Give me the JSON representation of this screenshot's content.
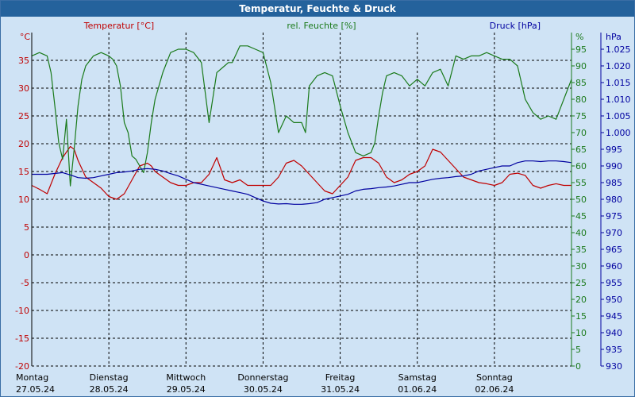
{
  "window": {
    "title": "Temperatur, Feuchte & Druck"
  },
  "colors": {
    "background": "#cfe3f5",
    "titlebar": "#24629c",
    "temperature": "#c00000",
    "humidity": "#1a7a1a",
    "pressure": "#0000a0",
    "grid": "#000000"
  },
  "chart_data": {
    "type": "line",
    "grid": true,
    "legend": "top",
    "axes": {
      "temperature": {
        "label": "Temperatur [°C]",
        "unit": "°C",
        "ylim": [
          -20,
          40
        ],
        "ticks": [
          -20,
          -15,
          -10,
          -5,
          0,
          5,
          10,
          15,
          20,
          25,
          30,
          35
        ]
      },
      "humidity": {
        "label": "rel. Feuchte [%]",
        "unit": "%",
        "ylim": [
          0,
          100
        ],
        "ticks": [
          0,
          5,
          10,
          15,
          20,
          25,
          30,
          35,
          40,
          45,
          50,
          55,
          60,
          65,
          70,
          75,
          80,
          85,
          90,
          95
        ]
      },
      "pressure": {
        "label": "Druck [hPa]",
        "unit": "hPa",
        "ylim": [
          930,
          1030
        ],
        "ticks": [
          "930",
          "935",
          "940",
          "945",
          "950",
          "955",
          "960",
          "965",
          "970",
          "975",
          "980",
          "985",
          "990",
          "995",
          "1.000",
          "1.005",
          "1.010",
          "1.015",
          "1.020",
          "1.025"
        ]
      }
    },
    "x_range": [
      0,
      7
    ],
    "days": [
      {
        "weekday": "Montag",
        "date": "27.05.24"
      },
      {
        "weekday": "Dienstag",
        "date": "28.05.24"
      },
      {
        "weekday": "Mittwoch",
        "date": "29.05.24"
      },
      {
        "weekday": "Donnerstag",
        "date": "30.05.24"
      },
      {
        "weekday": "Freitag",
        "date": "31.05.24"
      },
      {
        "weekday": "Samstag",
        "date": "01.06.24"
      },
      {
        "weekday": "Sonntag",
        "date": "02.06.24"
      }
    ],
    "series": [
      {
        "name": "Temperatur [°C]",
        "axis": "temperature",
        "x": [
          0,
          0.1,
          0.2,
          0.3,
          0.4,
          0.5,
          0.55,
          0.6,
          0.7,
          0.8,
          0.9,
          1.0,
          1.1,
          1.2,
          1.3,
          1.4,
          1.5,
          1.55,
          1.6,
          1.7,
          1.8,
          1.9,
          2.0,
          2.1,
          2.2,
          2.3,
          2.4,
          2.5,
          2.6,
          2.7,
          2.8,
          2.9,
          3.0,
          3.1,
          3.2,
          3.3,
          3.4,
          3.5,
          3.6,
          3.7,
          3.8,
          3.9,
          4.0,
          4.1,
          4.2,
          4.3,
          4.4,
          4.5,
          4.6,
          4.7,
          4.8,
          4.9,
          5.0,
          5.1,
          5.2,
          5.3,
          5.4,
          5.5,
          5.6,
          5.7,
          5.8,
          5.9,
          6.0,
          6.1,
          6.2,
          6.3,
          6.4,
          6.5,
          6.6,
          6.7,
          6.8,
          6.9,
          7.0
        ],
        "values": [
          12.5,
          11.8,
          11.0,
          14.5,
          17.5,
          19.5,
          19.0,
          17.0,
          14.0,
          13.0,
          12.0,
          10.5,
          10.0,
          11.0,
          13.5,
          16.0,
          16.5,
          16.0,
          15.0,
          14.0,
          13.0,
          12.5,
          12.5,
          13.0,
          13.0,
          14.5,
          17.5,
          13.5,
          13.0,
          13.5,
          12.5,
          12.5,
          12.5,
          12.5,
          14.0,
          16.5,
          17.0,
          16.0,
          14.5,
          13.0,
          11.5,
          11.0,
          12.5,
          14.0,
          17.0,
          17.5,
          17.5,
          16.5,
          14.0,
          13.0,
          13.5,
          14.5,
          15.0,
          16.0,
          19.0,
          18.5,
          17.0,
          15.5,
          14.0,
          13.5,
          13.0,
          12.8,
          12.5,
          13.0,
          14.5,
          14.7,
          14.3,
          12.5,
          12.0,
          12.5,
          12.8,
          12.5,
          12.5
        ]
      },
      {
        "name": "rel. Feuchte [%]",
        "axis": "humidity",
        "x": [
          0,
          0.1,
          0.2,
          0.25,
          0.3,
          0.35,
          0.4,
          0.45,
          0.5,
          0.55,
          0.6,
          0.65,
          0.7,
          0.8,
          0.9,
          1.0,
          1.05,
          1.1,
          1.15,
          1.2,
          1.25,
          1.3,
          1.35,
          1.4,
          1.45,
          1.5,
          1.55,
          1.6,
          1.7,
          1.8,
          1.9,
          2.0,
          2.1,
          2.2,
          2.3,
          2.4,
          2.5,
          2.55,
          2.6,
          2.7,
          2.8,
          2.9,
          3.0,
          3.1,
          3.2,
          3.3,
          3.4,
          3.5,
          3.55,
          3.6,
          3.7,
          3.8,
          3.9,
          4.0,
          4.1,
          4.2,
          4.3,
          4.4,
          4.45,
          4.5,
          4.55,
          4.6,
          4.7,
          4.8,
          4.9,
          5.0,
          5.1,
          5.2,
          5.3,
          5.4,
          5.5,
          5.6,
          5.7,
          5.8,
          5.9,
          6.0,
          6.1,
          6.2,
          6.3,
          6.4,
          6.5,
          6.55,
          6.6,
          6.7,
          6.8,
          6.9,
          7.0
        ],
        "values": [
          93,
          94,
          93,
          88,
          78,
          67,
          62,
          74,
          54,
          65,
          78,
          86,
          90,
          93,
          94,
          93,
          92,
          90,
          84,
          73,
          70,
          63,
          62,
          60,
          58,
          64,
          73,
          80,
          88,
          94,
          95,
          95,
          94,
          91,
          73,
          88,
          90,
          91,
          91,
          96,
          96,
          95,
          94,
          85,
          70,
          75,
          73,
          73,
          70,
          84,
          87,
          88,
          87,
          78,
          70,
          64,
          63,
          64,
          67,
          75,
          82,
          87,
          88,
          87,
          84,
          86,
          84,
          88,
          89,
          84,
          93,
          92,
          93,
          93,
          94,
          93,
          92,
          92,
          90,
          80,
          76,
          75,
          74,
          75,
          74,
          80,
          86
        ]
      },
      {
        "name": "Druck [hPa]",
        "axis": "pressure",
        "x": [
          0,
          0.2,
          0.4,
          0.5,
          0.6,
          0.7,
          0.8,
          0.9,
          1.0,
          1.1,
          1.2,
          1.3,
          1.4,
          1.5,
          1.6,
          1.7,
          1.8,
          1.9,
          2.0,
          2.1,
          2.2,
          2.3,
          2.4,
          2.5,
          2.6,
          2.7,
          2.8,
          2.9,
          3.0,
          3.1,
          3.2,
          3.3,
          3.4,
          3.5,
          3.6,
          3.7,
          3.8,
          3.9,
          4.0,
          4.1,
          4.2,
          4.3,
          4.4,
          4.5,
          4.6,
          4.7,
          4.8,
          4.9,
          5.0,
          5.1,
          5.2,
          5.3,
          5.4,
          5.5,
          5.6,
          5.7,
          5.8,
          5.9,
          6.0,
          6.1,
          6.2,
          6.3,
          6.4,
          6.5,
          6.6,
          6.7,
          6.8,
          6.9,
          7.0
        ],
        "values": [
          987.5,
          987.5,
          988,
          987.3,
          986.5,
          986.3,
          986.5,
          987,
          987.5,
          988,
          988.2,
          988.5,
          989,
          989.2,
          989,
          988.5,
          987.7,
          987,
          986,
          985,
          984.5,
          984,
          983.5,
          983,
          982.5,
          982,
          981.5,
          980.5,
          979.5,
          978.8,
          978.6,
          978.7,
          978.5,
          978.5,
          978.7,
          979,
          980,
          980.5,
          981,
          981.5,
          982.5,
          983,
          983.2,
          983.5,
          983.7,
          984,
          984.5,
          985,
          985,
          985.5,
          986,
          986.3,
          986.5,
          986.8,
          987,
          987.5,
          988.5,
          989,
          989.5,
          990,
          990,
          991,
          991.5,
          991.5,
          991.3,
          991.5,
          991.5,
          991.3,
          991
        ]
      }
    ]
  }
}
